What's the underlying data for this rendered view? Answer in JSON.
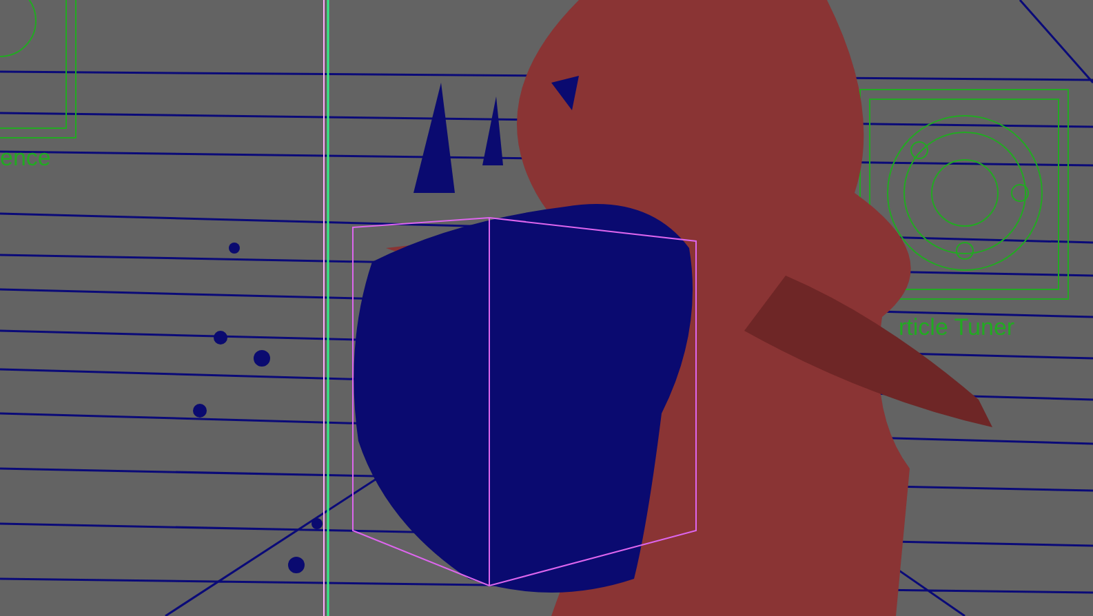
{
  "viewport": {
    "labels": [
      {
        "text": "ence"
      },
      {
        "text": "rticle Tuner"
      }
    ]
  }
}
